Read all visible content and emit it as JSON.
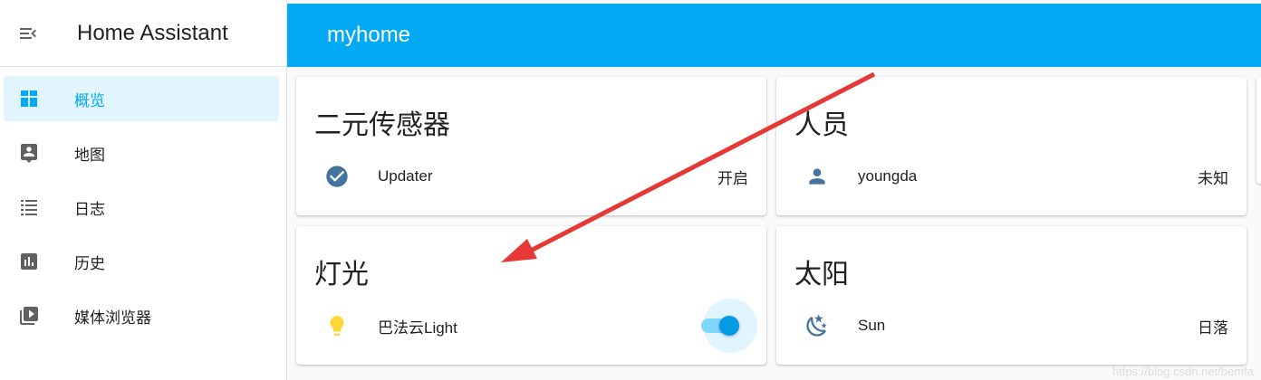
{
  "app": {
    "title": "Home Assistant"
  },
  "sidebar": {
    "items": [
      {
        "label": "概览",
        "icon": "dashboard-icon",
        "active": true
      },
      {
        "label": "地图",
        "icon": "map-account-icon",
        "active": false
      },
      {
        "label": "日志",
        "icon": "logbook-icon",
        "active": false
      },
      {
        "label": "历史",
        "icon": "history-chart-icon",
        "active": false
      },
      {
        "label": "媒体浏览器",
        "icon": "media-play-icon",
        "active": false
      }
    ]
  },
  "header": {
    "title": "myhome"
  },
  "cards": {
    "binary_sensor": {
      "title": "二元传感器",
      "entity_name": "Updater",
      "entity_state": "开启",
      "icon": "check-circle-icon"
    },
    "person": {
      "title": "人员",
      "entity_name": "youngda",
      "entity_state": "未知",
      "icon": "account-icon"
    },
    "light": {
      "title": "灯光",
      "entity_name": "巴法云Light",
      "entity_on": true,
      "icon": "lightbulb-icon"
    },
    "sun": {
      "title": "太阳",
      "entity_name": "Sun",
      "entity_state": "日落",
      "icon": "weather-night-icon"
    }
  },
  "watermark": "https://blog.csdn.net/bemfa",
  "colors": {
    "primary": "#03a9f4",
    "icon": "#44739e",
    "light_on": "#fdd835",
    "annotation_arrow": "#e53935"
  }
}
